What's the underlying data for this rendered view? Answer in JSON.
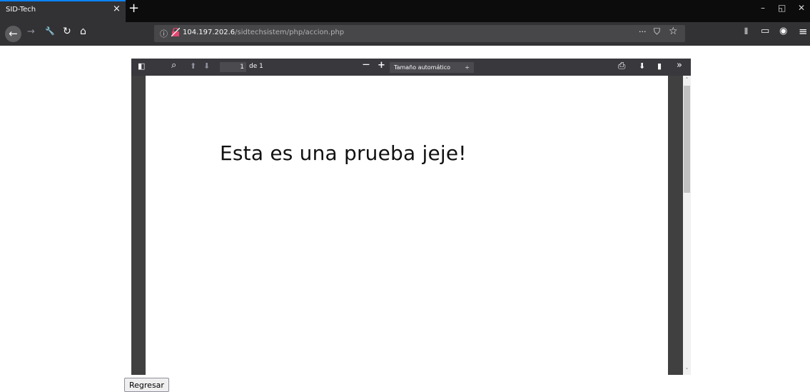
{
  "browser": {
    "tab": {
      "title": "SID-Tech",
      "close_icon": "×"
    },
    "new_tab_icon": "+",
    "window_controls": {
      "minimize": "–",
      "restore": "◱",
      "close": "✕"
    },
    "nav": {
      "back": "←",
      "forward": "→",
      "tools": "🔧",
      "reload": "↻",
      "home": "⌂"
    },
    "url": {
      "info_icon": "ⓘ",
      "host": "104.197.202.6",
      "path": "/sidtechsistem/php/accion.php",
      "more": "···",
      "pocket": "⛉",
      "star": "☆"
    },
    "right_icons": {
      "library": "⫴",
      "sidebar": "▭",
      "account": "◉",
      "menu": "≡"
    }
  },
  "pdf": {
    "toolbar": {
      "sidebar_toggle": "◧",
      "search": "⌕",
      "prev": "⬆",
      "next": "⬇",
      "page_number": "1",
      "page_of": "de 1",
      "zoom_out": "—",
      "zoom_in": "+",
      "zoom_value": "Tamaño automático",
      "zoom_arrow": "÷",
      "print": "⎙",
      "download": "⬇",
      "bookmark": "▮",
      "tools": "»"
    },
    "page_text": "Esta es una prueba jeje!",
    "scroll_up": "˄",
    "scroll_down": "˅"
  },
  "back_button_label": "Regresar",
  "colors": {
    "tab_accent": "#0a84ff",
    "lock_icon": "#e5446d"
  }
}
